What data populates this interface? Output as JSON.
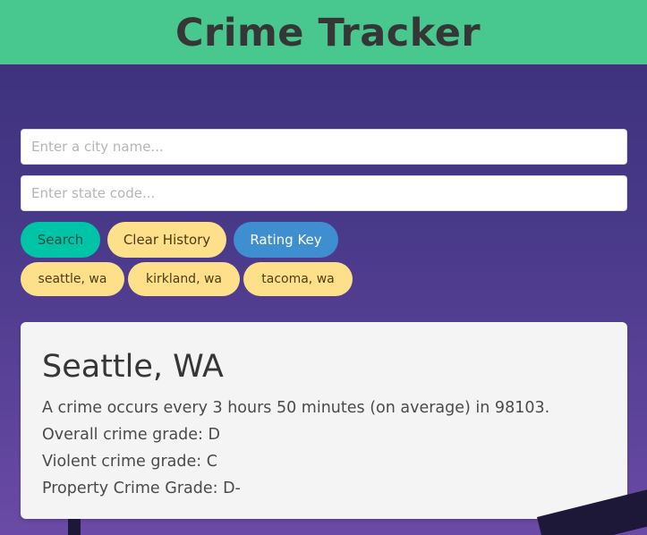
{
  "header": {
    "title": "Crime Tracker"
  },
  "search": {
    "city_placeholder": "Enter a city name...",
    "city_value": "",
    "state_placeholder": "Enter state code...",
    "state_value": ""
  },
  "buttons": {
    "search_label": "Search",
    "clear_label": "Clear History",
    "rating_key_label": "Rating Key"
  },
  "history": [
    "seattle, wa",
    "kirkland, wa",
    "tacoma, wa"
  ],
  "result": {
    "city": "Seattle, WA",
    "frequency_text": "A crime occurs every 3 hours 50 minutes (on average) in 98103.",
    "overall_text": "Overall crime grade: D",
    "violent_text": "Violent crime grade: C",
    "property_text": "Property Crime Grade: D-"
  },
  "colors": {
    "header_bg": "#48c78e",
    "search_button": "#00c4a7",
    "warning_button": "#ffe08a",
    "info_button": "#3e8ed0",
    "page_bg_top": "#3a2f78",
    "page_bg_bottom": "#6a4aa6",
    "card_bg": "#f4f4f4"
  }
}
